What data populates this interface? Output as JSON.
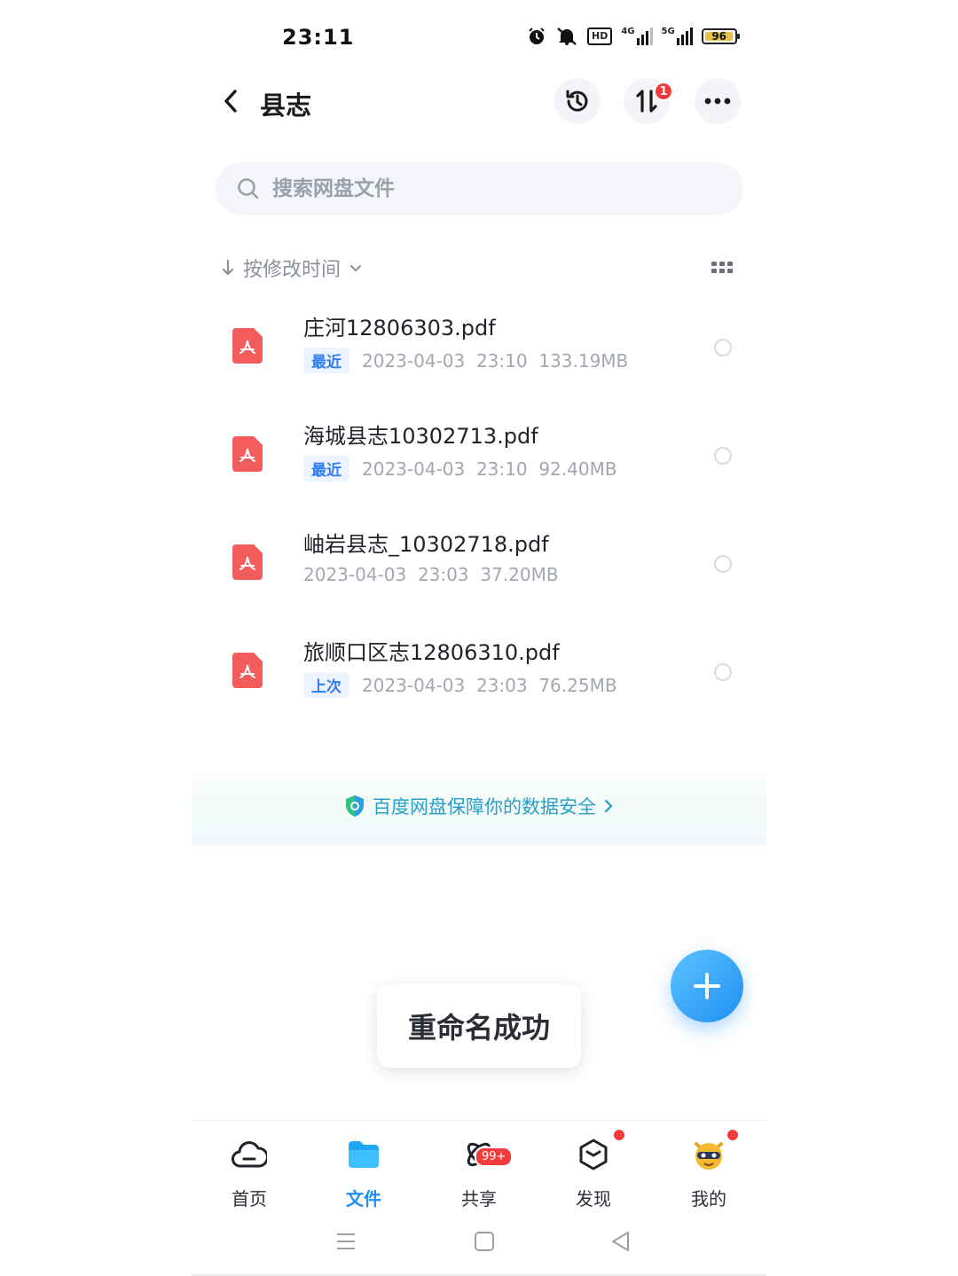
{
  "status_bar": {
    "time": "23:11",
    "network_4g": "4G",
    "network_5g": "5G",
    "hd_label": "HD",
    "battery_level": "96"
  },
  "header": {
    "title": "县志",
    "transfer_badge": "1"
  },
  "search": {
    "placeholder": "搜索网盘文件"
  },
  "sort": {
    "label": "按修改时间"
  },
  "files": [
    {
      "name": "庄河12806303.pdf",
      "tag": "最近",
      "date": "2023-04-03",
      "time": "23:10",
      "size": "133.19MB"
    },
    {
      "name": "海城县志10302713.pdf",
      "tag": "最近",
      "date": "2023-04-03",
      "time": "23:10",
      "size": "92.40MB"
    },
    {
      "name": "岫岩县志_10302718.pdf",
      "tag": "",
      "date": "2023-04-03",
      "time": "23:03",
      "size": "37.20MB"
    },
    {
      "name": "旅顺口区志12806310.pdf",
      "tag": "上次",
      "date": "2023-04-03",
      "time": "23:03",
      "size": "76.25MB"
    }
  ],
  "banner": {
    "text": "百度网盘保障你的数据安全"
  },
  "toast": {
    "text": "重命名成功"
  },
  "bottom_nav": {
    "items": [
      {
        "label": "首页",
        "icon": "cloud-icon",
        "active": false
      },
      {
        "label": "文件",
        "icon": "folder-icon",
        "active": true
      },
      {
        "label": "共享",
        "icon": "share-icon",
        "active": false,
        "badge": "99+"
      },
      {
        "label": "发现",
        "icon": "discover-icon",
        "active": false
      },
      {
        "label": "我的",
        "icon": "avatar-icon",
        "active": false
      }
    ]
  },
  "colors": {
    "accent": "#1e90f5",
    "pdf_red": "#f25c5c",
    "badge_red": "#f23c3c",
    "tag_blue": "#2f7cf6"
  }
}
